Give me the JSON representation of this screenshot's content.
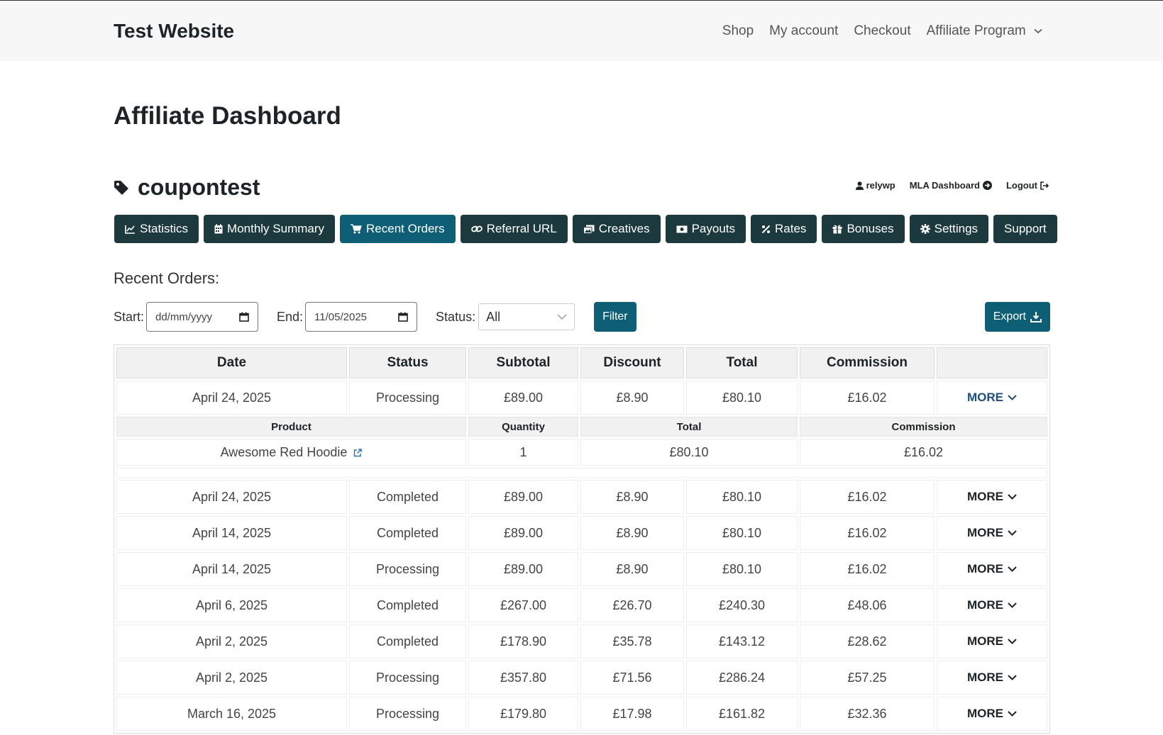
{
  "site": {
    "title": "Test Website",
    "nav": [
      "Shop",
      "My account",
      "Checkout",
      "Affiliate Program"
    ]
  },
  "page": {
    "title": "Affiliate Dashboard"
  },
  "affiliate": {
    "name": "coupontest",
    "user": "relywp",
    "dashboard_link": "MLA Dashboard",
    "logout": "Logout"
  },
  "tabs": [
    {
      "label": "Statistics",
      "icon": "chart-icon"
    },
    {
      "label": "Monthly Summary",
      "icon": "calendar-icon"
    },
    {
      "label": "Recent Orders",
      "icon": "cart-icon",
      "active": true
    },
    {
      "label": "Referral URL",
      "icon": "link-icon"
    },
    {
      "label": "Creatives",
      "icon": "images-icon"
    },
    {
      "label": "Payouts",
      "icon": "money-icon"
    },
    {
      "label": "Rates",
      "icon": "percent-icon"
    },
    {
      "label": "Bonuses",
      "icon": "gift-icon"
    },
    {
      "label": "Settings",
      "icon": "gear-icon"
    },
    {
      "label": "Support",
      "icon": ""
    }
  ],
  "section": {
    "title": "Recent Orders:"
  },
  "filters": {
    "start_label": "Start:",
    "start_value": "dd/mm/yyyy",
    "end_label": "End:",
    "end_value": "11/05/2025",
    "status_label": "Status:",
    "status_value": "All",
    "filter_button": "Filter",
    "export_button": "Export"
  },
  "table": {
    "headers": [
      "Date",
      "Status",
      "Subtotal",
      "Discount",
      "Total",
      "Commission",
      ""
    ],
    "more_label": "MORE",
    "detail_headers": [
      "Product",
      "Quantity",
      "Total",
      "Commission"
    ],
    "detail": {
      "product": "Awesome Red Hoodie",
      "quantity": "1",
      "total": "£80.10",
      "commission": "£16.02"
    },
    "rows": [
      [
        "April 24, 2025",
        "Processing",
        "£89.00",
        "£8.90",
        "£80.10",
        "£16.02"
      ],
      [
        "April 24, 2025",
        "Completed",
        "£89.00",
        "£8.90",
        "£80.10",
        "£16.02"
      ],
      [
        "April 14, 2025",
        "Completed",
        "£89.00",
        "£8.90",
        "£80.10",
        "£16.02"
      ],
      [
        "April 14, 2025",
        "Processing",
        "£89.00",
        "£8.90",
        "£80.10",
        "£16.02"
      ],
      [
        "April 6, 2025",
        "Completed",
        "£267.00",
        "£26.70",
        "£240.30",
        "£48.06"
      ],
      [
        "April 2, 2025",
        "Completed",
        "£178.90",
        "£35.78",
        "£143.12",
        "£28.62"
      ],
      [
        "April 2, 2025",
        "Processing",
        "£357.80",
        "£71.56",
        "£286.24",
        "£57.25"
      ],
      [
        "March 16, 2025",
        "Processing",
        "£179.80",
        "£17.98",
        "£161.82",
        "£32.36"
      ]
    ]
  }
}
